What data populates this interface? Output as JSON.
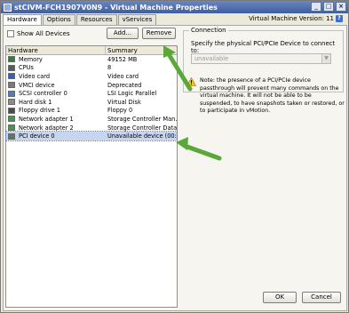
{
  "window": {
    "title": "stCIVM-FCH1907V0N9 - Virtual Machine Properties"
  },
  "tabs": [
    "Hardware",
    "Options",
    "Resources",
    "vServices"
  ],
  "version": "Virtual Machine Version: 11",
  "toolbar": {
    "show_all": "Show All Devices",
    "add": "Add...",
    "remove": "Remove"
  },
  "table": {
    "headers": [
      "Hardware",
      "Summary"
    ],
    "rows": [
      {
        "name": "Memory",
        "summary": "49152 MB",
        "icon": "memory-icon",
        "color": "#3a7a3a"
      },
      {
        "name": "CPUs",
        "summary": "8",
        "icon": "cpu-icon",
        "color": "#5a5a5a"
      },
      {
        "name": "Video card",
        "summary": "Video card",
        "icon": "video-card-icon",
        "color": "#2c62c6"
      },
      {
        "name": "VMCI device",
        "summary": "Deprecated",
        "icon": "vmci-icon",
        "color": "#7a7a7a"
      },
      {
        "name": "SCSI controller 0",
        "summary": "LSI Logic Parallel",
        "icon": "scsi-icon",
        "color": "#4d7fc0"
      },
      {
        "name": "Hard disk 1",
        "summary": "Virtual Disk",
        "icon": "hard-disk-icon",
        "color": "#8a8a8a"
      },
      {
        "name": "Floppy drive 1",
        "summary": "Floppy 0",
        "icon": "floppy-icon",
        "color": "#4a4a4a"
      },
      {
        "name": "Network adapter 1",
        "summary": "Storage Controller Man...",
        "icon": "network-icon",
        "color": "#3f9a4a"
      },
      {
        "name": "Network adapter 2",
        "summary": "Storage Controller Data...",
        "icon": "network-icon",
        "color": "#3f9a4a"
      },
      {
        "name": "PCI device 0",
        "summary": "Unavailable device (00:...",
        "icon": "pci-icon",
        "color": "#5a7a5a"
      }
    ]
  },
  "connection": {
    "group": "Connection",
    "label": "Specify the physical PCI/PCIe Device to connect to:",
    "selected": "unavailable"
  },
  "note": "Note: the presence of a PCI/PCIe device passthrough will prevent many commands on the virtual machine. It will not be able to be suspended, to have snapshots taken or restored, or to participate in vMotion.",
  "footer": {
    "ok": "OK",
    "cancel": "Cancel"
  },
  "colors": {
    "selected_row": "#c6d6f0",
    "title_bar": "#3e5e9e",
    "annotation_arrow": "#5aa83a"
  }
}
